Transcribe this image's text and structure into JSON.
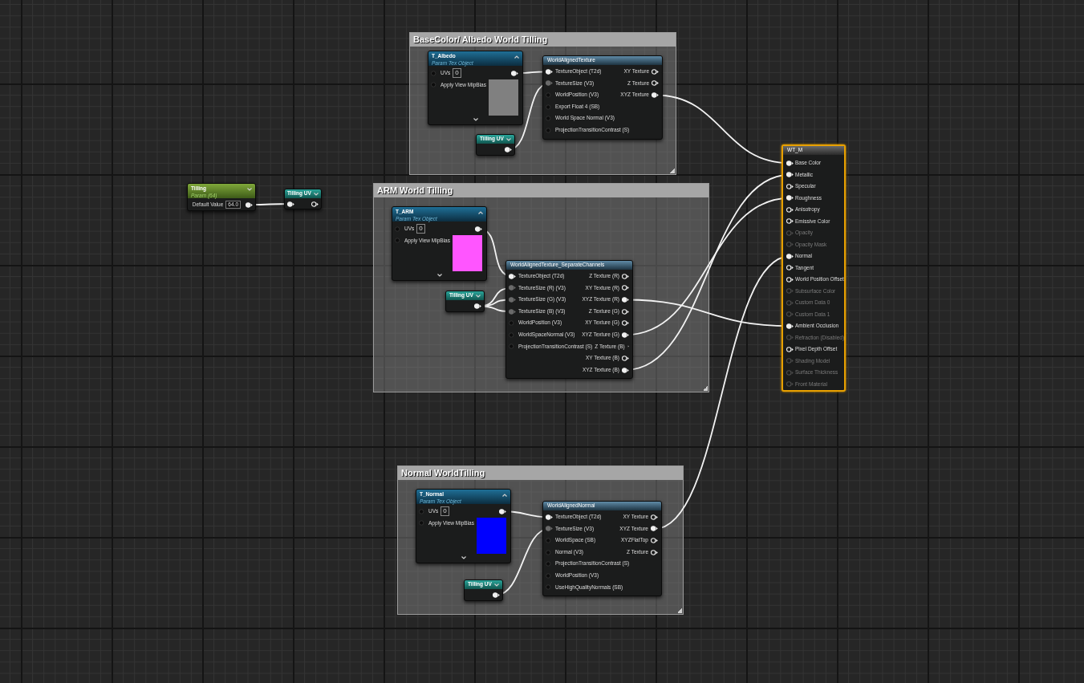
{
  "comments": [
    {
      "title": "BaseColor/ Albedo World Tilling"
    },
    {
      "title": "ARM World Tilling"
    },
    {
      "title": "Normal WorldTilling"
    }
  ],
  "scalar_parameter": {
    "title": "Tilling",
    "subtitle": "Param (64)",
    "field_label": "Default Value",
    "field_value": "64.0"
  },
  "named_reroute_declaration": {
    "title": "Tilling UV"
  },
  "texture_parameters": [
    {
      "title": "T_Albedo",
      "subtitle": "Param Tex Object",
      "uvs_label": "UVs",
      "uvs_value": "0",
      "mip_label": "Apply View MipBias",
      "color": "#808080"
    },
    {
      "title": "T_ARM",
      "subtitle": "Param Tex Object",
      "uvs_label": "UVs",
      "uvs_value": "0",
      "mip_label": "Apply View MipBias",
      "color": "#ff55ff"
    },
    {
      "title": "T_Normal",
      "subtitle": "Param Tex Object",
      "uvs_label": "UVs",
      "uvs_value": "0",
      "mip_label": "Apply View MipBias",
      "color": "#0000ff"
    }
  ],
  "reroute_usages": [
    {
      "title": "Tilling UV"
    },
    {
      "title": "Tilling UV"
    },
    {
      "title": "Tilling UV"
    }
  ],
  "functions": [
    {
      "title": "WorldAlignedTexture",
      "inputs": [
        {
          "label": "TextureObject (T2d)",
          "connected": true
        },
        {
          "label": "TextureSize (V3)",
          "connected": true
        },
        {
          "label": "WorldPosition (V3)",
          "connected": false
        },
        {
          "label": "Export Float 4 (SB)",
          "connected": false
        },
        {
          "label": "World Space Normal (V3)",
          "connected": false
        },
        {
          "label": "ProjectionTransitionContrast (S)",
          "connected": false
        }
      ],
      "outputs": [
        {
          "label": "XY Texture",
          "connected": false
        },
        {
          "label": "Z Texture",
          "connected": false
        },
        {
          "label": "XYZ Texture",
          "connected": true
        }
      ]
    },
    {
      "title": "WorldAlignedTexture_SeparateChannels",
      "inputs": [
        {
          "label": "TextureObject (T2d)",
          "connected": true
        },
        {
          "label": "TextureSize (R) (V3)",
          "connected": true
        },
        {
          "label": "TextureSize (G) (V3)",
          "connected": true
        },
        {
          "label": "TextureSize (B) (V3)",
          "connected": true
        },
        {
          "label": "WorldPosition (V3)",
          "connected": false
        },
        {
          "label": "WorldSpaceNormal (V3)",
          "connected": false
        },
        {
          "label": "ProjectionTransitionContrast (S)",
          "connected": false
        }
      ],
      "outputs": [
        {
          "label": "Z Texture (R)",
          "connected": false
        },
        {
          "label": "XY Texture (R)",
          "connected": false
        },
        {
          "label": "XYZ Texture (R)",
          "connected": true
        },
        {
          "label": "Z Texture (G)",
          "connected": false
        },
        {
          "label": "XY Texture (G)",
          "connected": false
        },
        {
          "label": "XYZ Texture (G)",
          "connected": true
        },
        {
          "label": "Z Texture (B)",
          "connected": false
        },
        {
          "label": "XY Texture (B)",
          "connected": false
        },
        {
          "label": "XYZ Texture (B)",
          "connected": true
        }
      ]
    },
    {
      "title": "WorldAlignedNormal",
      "inputs": [
        {
          "label": "TextureObject (T2d)",
          "connected": true
        },
        {
          "label": "TextureSize (V3)",
          "connected": true
        },
        {
          "label": "WorldSpace (SB)",
          "connected": false
        },
        {
          "label": "Normal (V3)",
          "connected": false
        },
        {
          "label": "ProjectionTransitionContrast (S)",
          "connected": false
        },
        {
          "label": "WorldPosition (V3)",
          "connected": false
        },
        {
          "label": "UseHighQualityNormals (SB)",
          "connected": false
        }
      ],
      "outputs": [
        {
          "label": "XY Texture",
          "connected": false
        },
        {
          "label": "XYZ Texture",
          "connected": true
        },
        {
          "label": "XYZFlatTop",
          "connected": false
        },
        {
          "label": "Z Texture",
          "connected": false
        }
      ]
    }
  ],
  "result": {
    "title": "WT_M",
    "pins": [
      {
        "label": "Base Color",
        "connected": true,
        "enabled": true
      },
      {
        "label": "Metallic",
        "connected": true,
        "enabled": true
      },
      {
        "label": "Specular",
        "connected": false,
        "enabled": true
      },
      {
        "label": "Roughness",
        "connected": true,
        "enabled": true
      },
      {
        "label": "Anisotropy",
        "connected": false,
        "enabled": true
      },
      {
        "label": "Emissive Color",
        "connected": false,
        "enabled": true
      },
      {
        "label": "Opacity",
        "connected": false,
        "enabled": false
      },
      {
        "label": "Opacity Mask",
        "connected": false,
        "enabled": false
      },
      {
        "label": "Normal",
        "connected": true,
        "enabled": true
      },
      {
        "label": "Tangent",
        "connected": false,
        "enabled": true
      },
      {
        "label": "World Position Offset",
        "connected": false,
        "enabled": true
      },
      {
        "label": "Subsurface Color",
        "connected": false,
        "enabled": false
      },
      {
        "label": "Custom Data 0",
        "connected": false,
        "enabled": false
      },
      {
        "label": "Custom Data 1",
        "connected": false,
        "enabled": false
      },
      {
        "label": "Ambient Occlusion",
        "connected": true,
        "enabled": true
      },
      {
        "label": "Refraction (Disabled)",
        "connected": false,
        "enabled": false
      },
      {
        "label": "Pixel Depth Offset",
        "connected": false,
        "enabled": true
      },
      {
        "label": "Shading Model",
        "connected": false,
        "enabled": false
      },
      {
        "label": "Surface Thickness",
        "connected": false,
        "enabled": false
      },
      {
        "label": "Front Material",
        "connected": false,
        "enabled": false
      }
    ]
  }
}
